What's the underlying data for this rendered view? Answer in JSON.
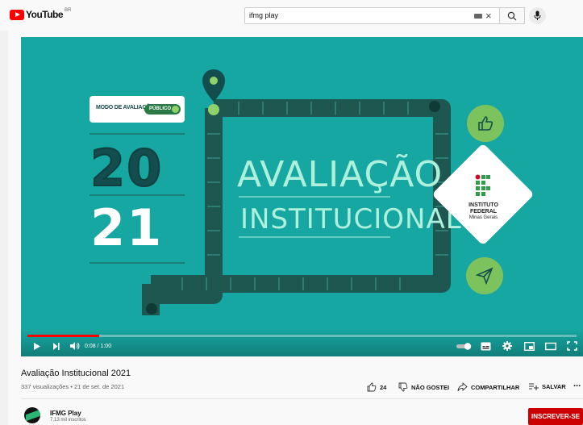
{
  "header": {
    "logo_text": "YouTube",
    "logo_country": "BR",
    "search_value": "ifmg play",
    "search_placeholder": "Pesquisar"
  },
  "video_frame": {
    "badge_text": "MODO DE AVALIAÇÃO",
    "badge_pill": "PÚBLICO",
    "year_top": "20",
    "year_bottom": "21",
    "title_line1": "AVALIAÇÃO",
    "title_line2": "INSTITUCIONAL",
    "org_line1": "INSTITUTO",
    "org_line2": "FEDERAL",
    "org_line3": "Minas Gerais",
    "colors": {
      "background": "#17a7a2",
      "track": "#1e5650",
      "accent_green": "#7cc35e"
    }
  },
  "player": {
    "time": "0:08 / 1:00",
    "progress_fraction": 0.13
  },
  "video": {
    "title": "Avaliação Institucional 2021",
    "meta": "337 visualizações • 21 de set. de 2021",
    "likes": "24",
    "dislike_label": "NÃO GOSTEI",
    "share_label": "COMPARTILHAR",
    "save_label": "SALVAR",
    "more_label": "..."
  },
  "channel": {
    "name": "IFMG Play",
    "subscribers": "7,13 mil inscritos",
    "subscribe_label": "INSCREVER-SE"
  }
}
